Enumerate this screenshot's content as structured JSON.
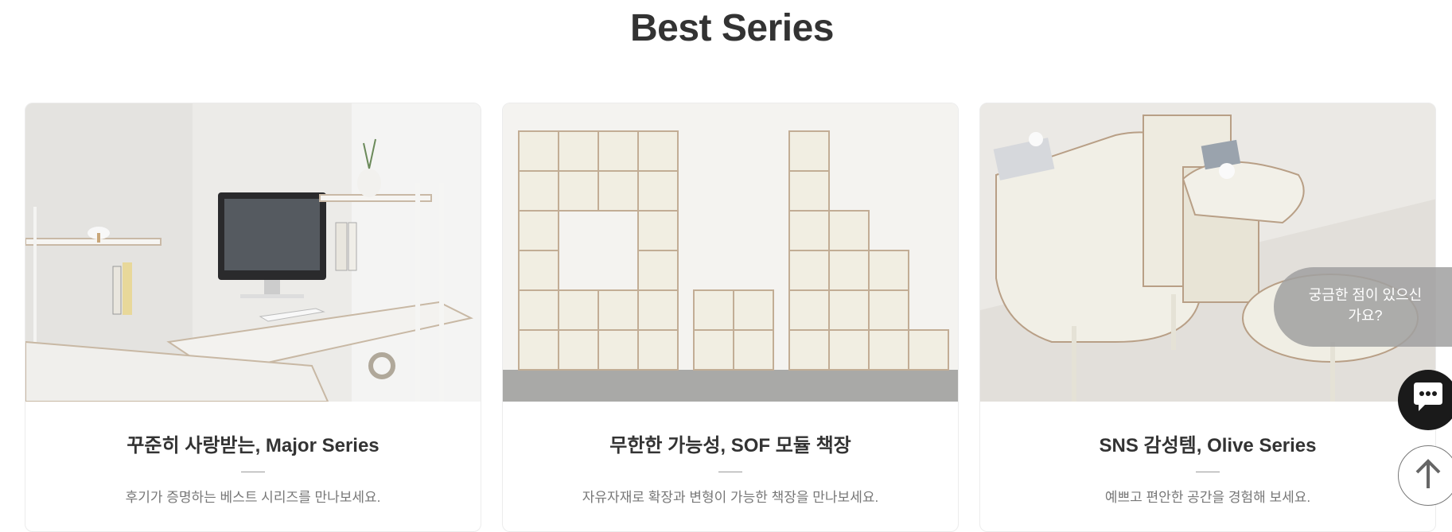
{
  "section": {
    "title": "Best Series"
  },
  "cards": [
    {
      "title": "꾸준히 사랑받는, Major Series",
      "description": "후기가 증명하는 베스트 시리즈를 만나보세요."
    },
    {
      "title": "무한한 가능성, SOF 모듈 책장",
      "description": "자유자재로 확장과 변형이 가능한 책장을 만나보세요."
    },
    {
      "title": "SNS 감성템, Olive Series",
      "description": "예쁘고 편안한 공간을 경험해 보세요."
    }
  ],
  "floating": {
    "chat_prompt": "궁금한 점이 있으신가요?",
    "chat_icon": "chat-icon",
    "top_icon": "arrow-up-icon"
  },
  "colors": {
    "title": "#333333",
    "chat_button": "#1a1a1a",
    "bubble": "#a0a0a0"
  }
}
